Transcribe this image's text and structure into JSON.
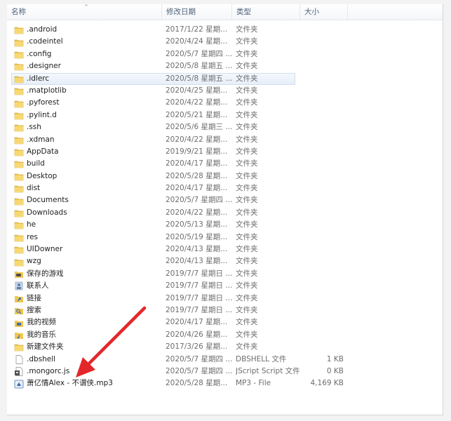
{
  "columns": {
    "name": "名称",
    "date": "修改日期",
    "type": "类型",
    "size": "大小"
  },
  "files": [
    {
      "name": ".android",
      "date": "2017/1/22 星期...",
      "type": "文件夹",
      "size": "",
      "icon": "folder-icon"
    },
    {
      "name": ".codeintel",
      "date": "2020/4/24 星期...",
      "type": "文件夹",
      "size": "",
      "icon": "folder-icon"
    },
    {
      "name": ".config",
      "date": "2020/5/7 星期四 ...",
      "type": "文件夹",
      "size": "",
      "icon": "folder-icon"
    },
    {
      "name": ".designer",
      "date": "2020/5/8 星期五 ...",
      "type": "文件夹",
      "size": "",
      "icon": "folder-icon"
    },
    {
      "name": ".idlerc",
      "date": "2020/5/8 星期五 ...",
      "type": "文件夹",
      "size": "",
      "icon": "folder-icon",
      "selected": true
    },
    {
      "name": ".matplotlib",
      "date": "2020/4/25 星期...",
      "type": "文件夹",
      "size": "",
      "icon": "folder-icon"
    },
    {
      "name": ".pyforest",
      "date": "2020/4/22 星期...",
      "type": "文件夹",
      "size": "",
      "icon": "folder-icon"
    },
    {
      "name": ".pylint.d",
      "date": "2020/5/21 星期...",
      "type": "文件夹",
      "size": "",
      "icon": "folder-icon"
    },
    {
      "name": ".ssh",
      "date": "2020/5/6 星期三 ...",
      "type": "文件夹",
      "size": "",
      "icon": "folder-icon"
    },
    {
      "name": ".xdman",
      "date": "2020/4/22 星期...",
      "type": "文件夹",
      "size": "",
      "icon": "folder-icon"
    },
    {
      "name": "AppData",
      "date": "2019/9/21 星期...",
      "type": "文件夹",
      "size": "",
      "icon": "folder-icon"
    },
    {
      "name": "build",
      "date": "2020/4/17 星期...",
      "type": "文件夹",
      "size": "",
      "icon": "folder-icon"
    },
    {
      "name": "Desktop",
      "date": "2020/5/28 星期...",
      "type": "文件夹",
      "size": "",
      "icon": "folder-icon"
    },
    {
      "name": "dist",
      "date": "2020/4/17 星期...",
      "type": "文件夹",
      "size": "",
      "icon": "folder-icon"
    },
    {
      "name": "Documents",
      "date": "2020/5/7 星期四 ...",
      "type": "文件夹",
      "size": "",
      "icon": "folder-icon"
    },
    {
      "name": "Downloads",
      "date": "2020/4/22 星期...",
      "type": "文件夹",
      "size": "",
      "icon": "folder-icon"
    },
    {
      "name": "he",
      "date": "2020/5/13 星期...",
      "type": "文件夹",
      "size": "",
      "icon": "folder-icon"
    },
    {
      "name": "res",
      "date": "2020/5/19 星期...",
      "type": "文件夹",
      "size": "",
      "icon": "folder-icon"
    },
    {
      "name": "UIDowner",
      "date": "2020/4/13 星期...",
      "type": "文件夹",
      "size": "",
      "icon": "folder-icon"
    },
    {
      "name": "wzg",
      "date": "2020/4/13 星期...",
      "type": "文件夹",
      "size": "",
      "icon": "folder-icon"
    },
    {
      "name": "保存的游戏",
      "date": "2019/7/7 星期日 ...",
      "type": "文件夹",
      "size": "",
      "icon": "saved-games-icon"
    },
    {
      "name": "联系人",
      "date": "2019/7/7 星期日 ...",
      "type": "文件夹",
      "size": "",
      "icon": "contacts-icon"
    },
    {
      "name": "链接",
      "date": "2019/7/7 星期日 ...",
      "type": "文件夹",
      "size": "",
      "icon": "links-icon"
    },
    {
      "name": "搜索",
      "date": "2019/7/7 星期日 ...",
      "type": "文件夹",
      "size": "",
      "icon": "searches-icon"
    },
    {
      "name": "我的视频",
      "date": "2020/4/17 星期...",
      "type": "文件夹",
      "size": "",
      "icon": "videos-folder-icon"
    },
    {
      "name": "我的音乐",
      "date": "2020/4/26 星期...",
      "type": "文件夹",
      "size": "",
      "icon": "music-folder-icon"
    },
    {
      "name": "新建文件夹",
      "date": "2017/3/26 星期...",
      "type": "文件夹",
      "size": "",
      "icon": "folder-icon"
    },
    {
      "name": ".dbshell",
      "date": "2020/5/7 星期四 ...",
      "type": "DBSHELL 文件",
      "size": "1 KB",
      "icon": "blank-file-icon"
    },
    {
      "name": ".mongorc.js",
      "date": "2020/5/7 星期四 ...",
      "type": "JScript Script 文件",
      "size": "0 KB",
      "icon": "script-file-icon"
    },
    {
      "name": "萧亿情Alex - 不谓侠.mp3",
      "date": "2020/5/28 星期...",
      "type": "MP3 - File",
      "size": "4,169 KB",
      "icon": "mp3-file-icon"
    }
  ],
  "colors": {
    "arrow": "#e3262a",
    "folder": "#f0c650",
    "selection": "#e6eef9"
  }
}
